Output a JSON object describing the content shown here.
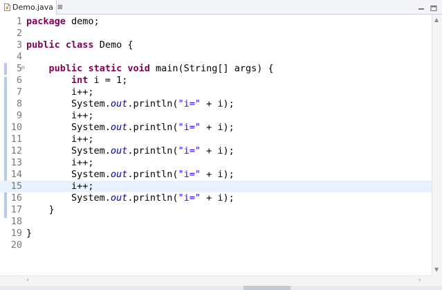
{
  "tab": {
    "title": "Demo.java",
    "close_glyph": "⊠"
  },
  "editor": {
    "lines": [
      {
        "n": "1",
        "segs": [
          {
            "t": "package",
            "c": "kw"
          },
          {
            "t": " demo;",
            "c": ""
          }
        ]
      },
      {
        "n": "2",
        "segs": []
      },
      {
        "n": "3",
        "segs": [
          {
            "t": "public",
            "c": "kw"
          },
          {
            "t": " ",
            "c": ""
          },
          {
            "t": "class",
            "c": "kw"
          },
          {
            "t": " Demo {",
            "c": ""
          }
        ]
      },
      {
        "n": "4",
        "segs": []
      },
      {
        "n": "5",
        "fold": "⊖",
        "segs": [
          {
            "t": "    ",
            "c": ""
          },
          {
            "t": "public",
            "c": "kw"
          },
          {
            "t": " ",
            "c": ""
          },
          {
            "t": "static",
            "c": "kw"
          },
          {
            "t": " ",
            "c": ""
          },
          {
            "t": "void",
            "c": "kw"
          },
          {
            "t": " main(String[] args) {",
            "c": ""
          }
        ]
      },
      {
        "n": "6",
        "segs": [
          {
            "t": "        ",
            "c": ""
          },
          {
            "t": "int",
            "c": "kw"
          },
          {
            "t": " i = 1;",
            "c": ""
          }
        ]
      },
      {
        "n": "7",
        "segs": [
          {
            "t": "        i++;",
            "c": ""
          }
        ]
      },
      {
        "n": "8",
        "segs": [
          {
            "t": "        System.",
            "c": ""
          },
          {
            "t": "out",
            "c": "fld"
          },
          {
            "t": ".println(",
            "c": ""
          },
          {
            "t": "\"i=\"",
            "c": "str"
          },
          {
            "t": " + i);",
            "c": ""
          }
        ]
      },
      {
        "n": "9",
        "segs": [
          {
            "t": "        i++;",
            "c": ""
          }
        ]
      },
      {
        "n": "10",
        "segs": [
          {
            "t": "        System.",
            "c": ""
          },
          {
            "t": "out",
            "c": "fld"
          },
          {
            "t": ".println(",
            "c": ""
          },
          {
            "t": "\"i=\"",
            "c": "str"
          },
          {
            "t": " + i);",
            "c": ""
          }
        ]
      },
      {
        "n": "11",
        "segs": [
          {
            "t": "        i++;",
            "c": ""
          }
        ]
      },
      {
        "n": "12",
        "segs": [
          {
            "t": "        System.",
            "c": ""
          },
          {
            "t": "out",
            "c": "fld"
          },
          {
            "t": ".println(",
            "c": ""
          },
          {
            "t": "\"i=\"",
            "c": "str"
          },
          {
            "t": " + i);",
            "c": ""
          }
        ]
      },
      {
        "n": "13",
        "segs": [
          {
            "t": "        i++;",
            "c": ""
          }
        ]
      },
      {
        "n": "14",
        "segs": [
          {
            "t": "        System.",
            "c": ""
          },
          {
            "t": "out",
            "c": "fld"
          },
          {
            "t": ".println(",
            "c": ""
          },
          {
            "t": "\"i=\"",
            "c": "str"
          },
          {
            "t": " + i);",
            "c": ""
          }
        ]
      },
      {
        "n": "15",
        "current": true,
        "segs": [
          {
            "t": "        i++;",
            "c": ""
          }
        ]
      },
      {
        "n": "16",
        "segs": [
          {
            "t": "        System.",
            "c": ""
          },
          {
            "t": "out",
            "c": "fld"
          },
          {
            "t": ".println(",
            "c": ""
          },
          {
            "t": "\"i=\"",
            "c": "str"
          },
          {
            "t": " + i);",
            "c": ""
          }
        ]
      },
      {
        "n": "17",
        "segs": [
          {
            "t": "    }",
            "c": ""
          }
        ]
      },
      {
        "n": "18",
        "segs": []
      },
      {
        "n": "19",
        "segs": [
          {
            "t": "}",
            "c": ""
          }
        ]
      },
      {
        "n": "20",
        "segs": []
      }
    ]
  },
  "colors": {
    "keyword": "#7f0055",
    "field": "#0000c0",
    "string": "#2a00ff",
    "line_number": "#787878",
    "current_line": "#e8f2fe",
    "gutter_marker": "#b5cbe8"
  },
  "icons": {
    "file": "java-file-icon",
    "minimize": "minimize-icon",
    "maximize": "maximize-icon"
  },
  "scroll": {
    "up": "▲",
    "down": "▼",
    "left": "‹",
    "right": "›"
  }
}
